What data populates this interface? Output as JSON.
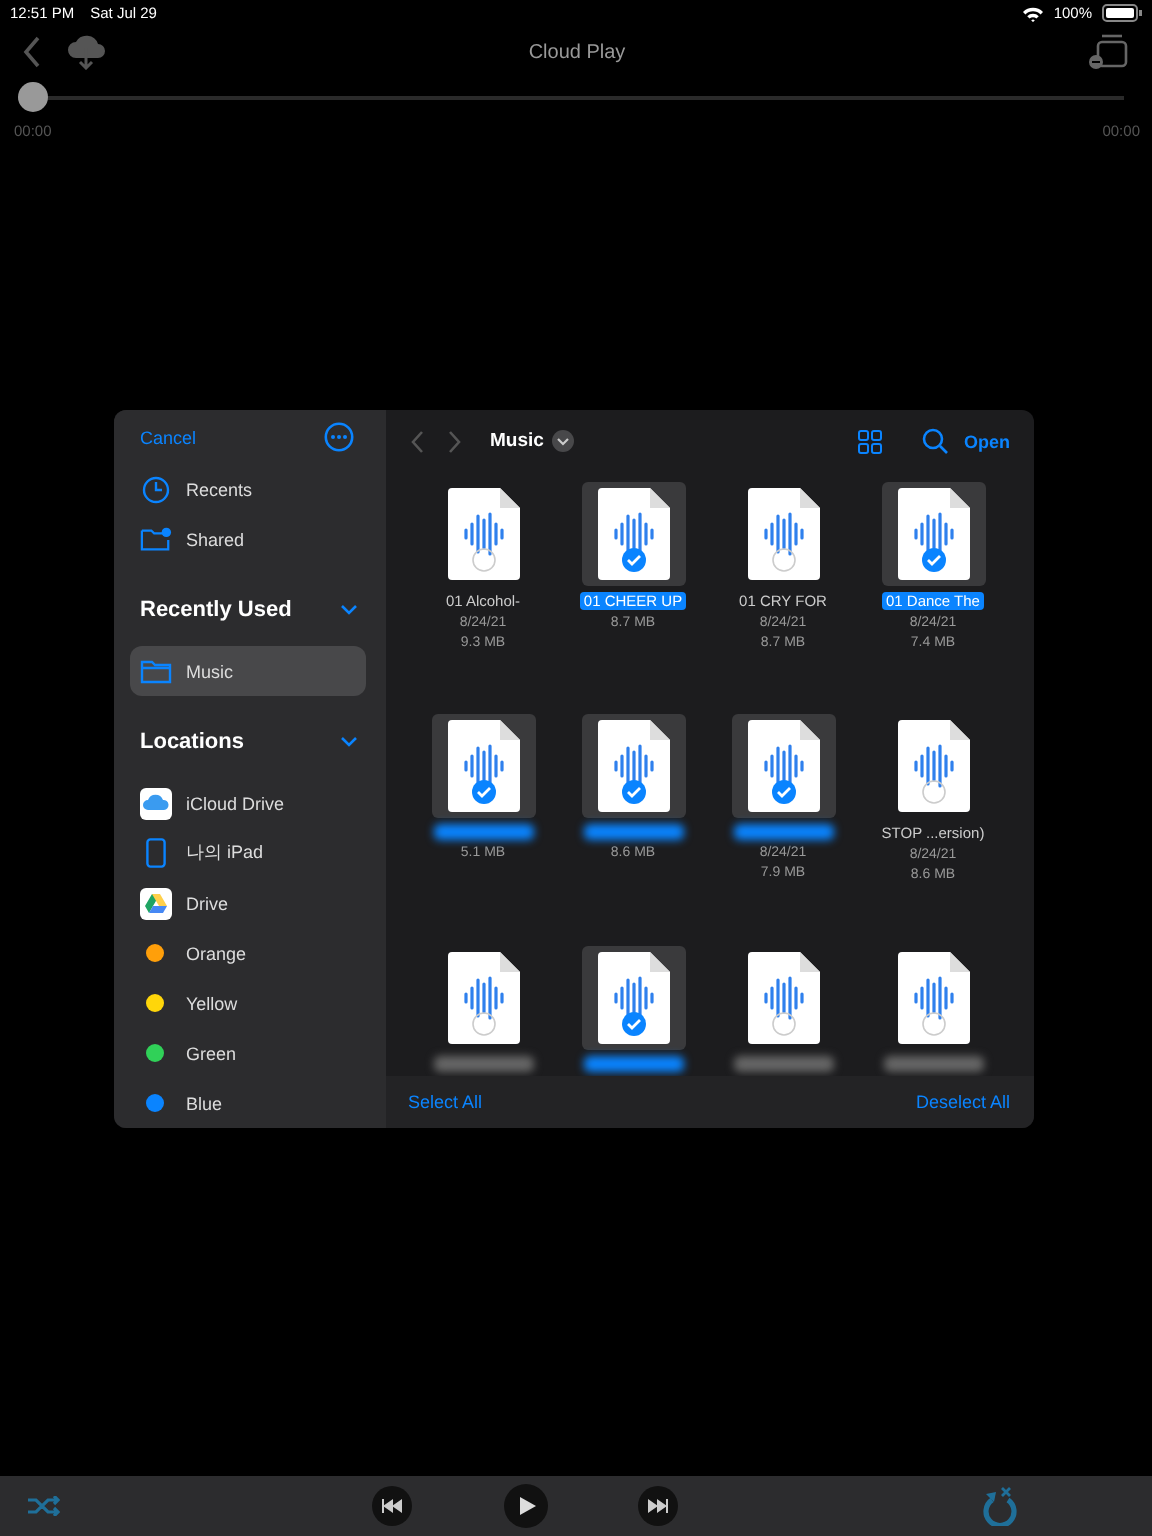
{
  "status_bar": {
    "time": "12:51 PM",
    "date": "Sat Jul 29",
    "battery": "100%"
  },
  "header": {
    "title": "Cloud Play"
  },
  "progress": {
    "level": 0,
    "elapsed": "00:00",
    "total": "00:00"
  },
  "picker": {
    "cancel": "Cancel",
    "folder": "Music",
    "open": "Open",
    "select_all": "Select All",
    "deselect_all": "Deselect All",
    "top_items": [
      {
        "kind": "recents",
        "label": "Recents"
      },
      {
        "kind": "shared",
        "label": "Shared"
      }
    ],
    "recent_title": "Recently Used",
    "recent_items": [
      {
        "kind": "folder",
        "label": "Music",
        "selected": true
      }
    ],
    "locations_title": "Locations",
    "locations": [
      {
        "kind": "icloud",
        "label": "iCloud Drive"
      },
      {
        "kind": "ipad",
        "label": "나의 iPad"
      },
      {
        "kind": "drive",
        "label": "Drive"
      },
      {
        "kind": "tag",
        "label": "Orange",
        "color": "#ff9f0a"
      },
      {
        "kind": "tag",
        "label": "Yellow",
        "color": "#ffd60a"
      },
      {
        "kind": "tag",
        "label": "Green",
        "color": "#30d158"
      },
      {
        "kind": "tag",
        "label": "Blue",
        "color": "#0a84ff"
      }
    ],
    "files": [
      {
        "name": "01 Alcohol-",
        "date": "8/24/21",
        "size": "9.3 MB",
        "selected": false
      },
      {
        "name": "01 CHEER UP",
        "size": "8.7 MB",
        "selected": true
      },
      {
        "name": "01 CRY FOR",
        "date": "8/24/21",
        "size": "8.7 MB",
        "selected": false
      },
      {
        "name": "01 Dance The",
        "date": "8/24/21",
        "size": "7.4 MB",
        "selected": true
      },
      {
        "size": "5.1 MB",
        "selected": true
      },
      {
        "size": "8.6 MB",
        "selected": true
      },
      {
        "date": "8/24/21",
        "size": "7.9 MB",
        "selected": true
      },
      {
        "name": "STOP ...ersion)",
        "date": "8/24/21",
        "size": "8.6 MB",
        "selected": false
      },
      {
        "selected": false
      },
      {
        "selected": true
      },
      {
        "selected": false
      },
      {
        "selected": false
      }
    ]
  }
}
